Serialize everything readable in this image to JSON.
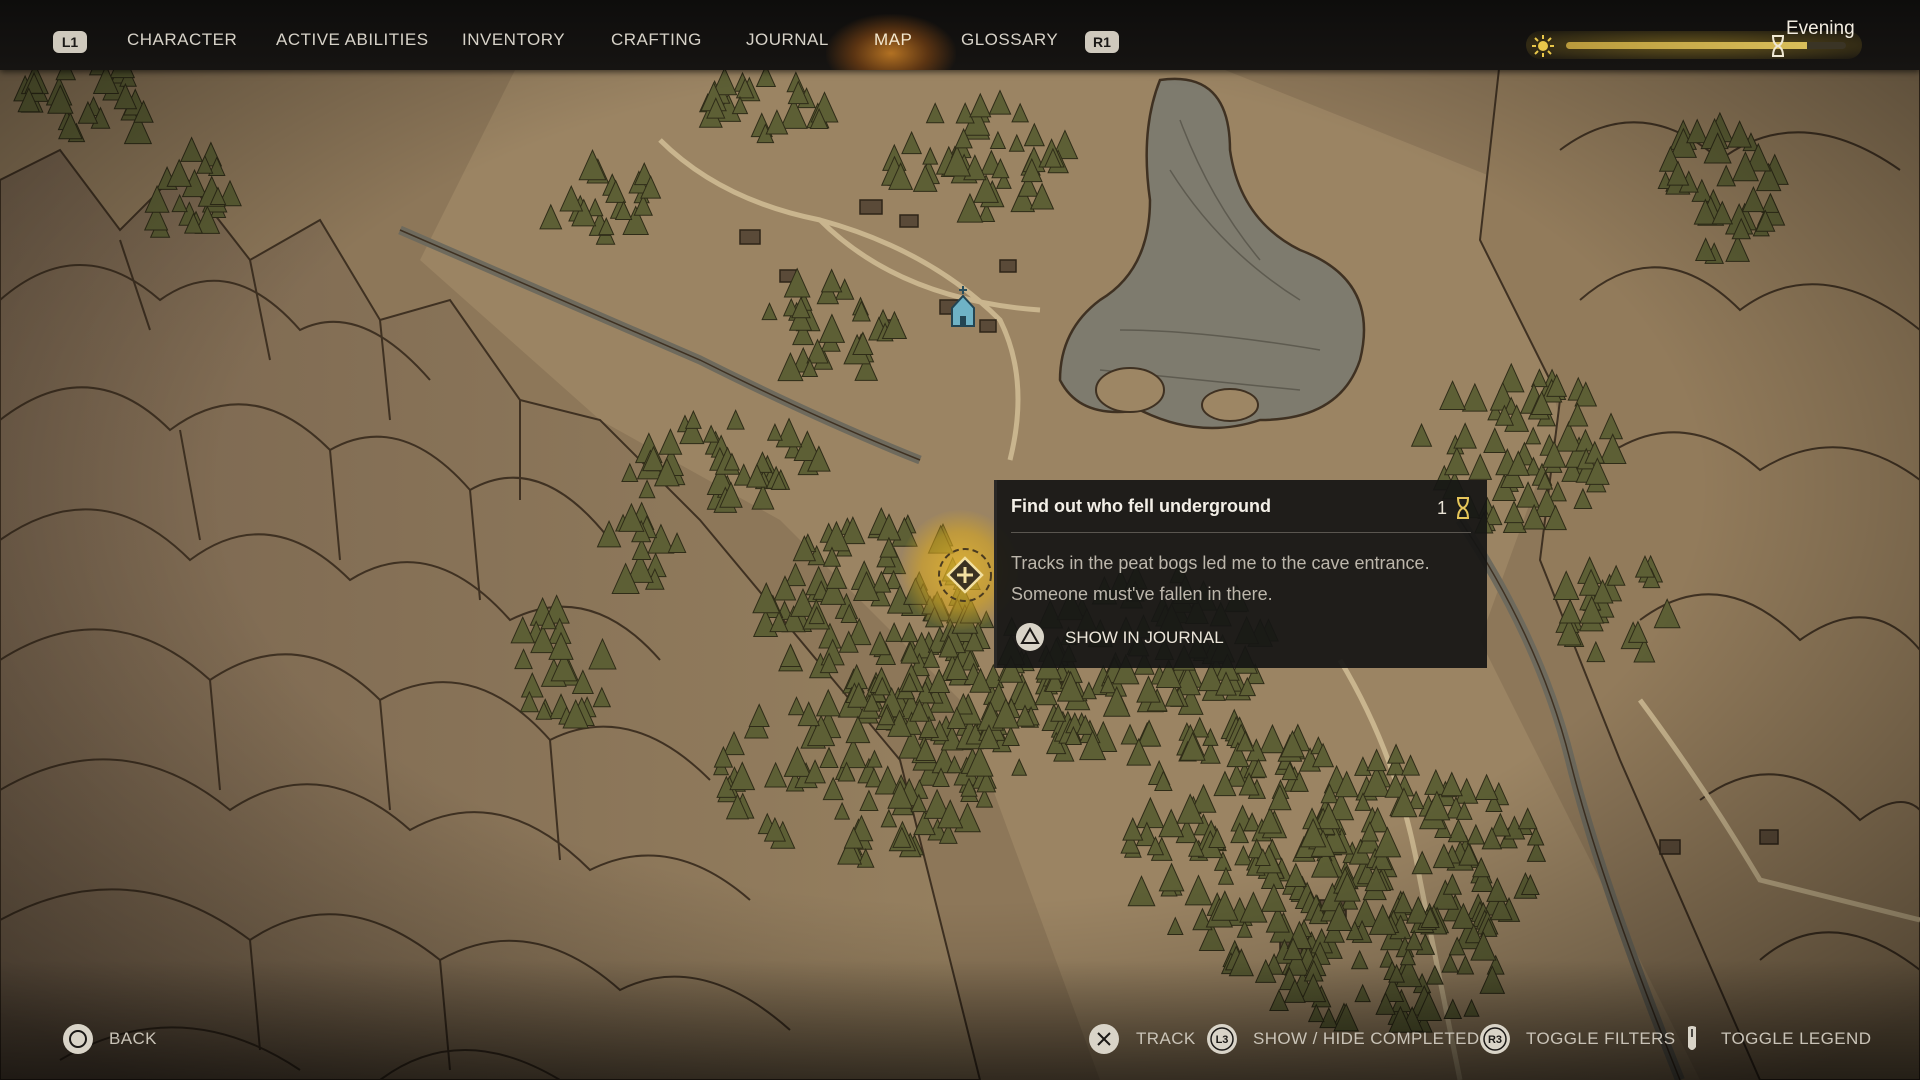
{
  "topbar": {
    "left_shoulder": "L1",
    "right_shoulder": "R1",
    "tabs": [
      {
        "label": "CHARACTER"
      },
      {
        "label": "ACTIVE ABILITIES"
      },
      {
        "label": "INVENTORY"
      },
      {
        "label": "CRAFTING"
      },
      {
        "label": "JOURNAL"
      },
      {
        "label": "MAP",
        "active": true
      },
      {
        "label": "GLOSSARY"
      }
    ],
    "time_of_day": "Evening",
    "time_progress": 0.86,
    "icons": {
      "sun": "sun-icon",
      "time_marker": "hourglass-icon"
    }
  },
  "map": {
    "markers": [
      "church-icon",
      "quest-marker-icon"
    ]
  },
  "quest_tooltip": {
    "title": "Find out who fell underground",
    "count": "1",
    "count_icon": "hourglass-icon",
    "description": "Tracks in the peat bogs led me to the cave entrance. Someone must've fallen in there.",
    "action": {
      "icon": "triangle-button-icon",
      "label": "SHOW IN JOURNAL"
    }
  },
  "hints": {
    "back": {
      "icon": "circle-button-icon",
      "label": "BACK"
    },
    "track": {
      "icon": "cross-button-icon",
      "label": "TRACK"
    },
    "show_hide": {
      "icon": "l3-button-icon",
      "label": "SHOW / HIDE COMPLETED"
    },
    "filters": {
      "icon": "r3-button-icon",
      "label": "TOGGLE FILTERS"
    },
    "legend": {
      "icon": "touchpad-icon",
      "label": "TOGGLE LEGEND"
    }
  },
  "colors": {
    "parchment": "#8a7458",
    "ink": "#4a3b2a",
    "forest": "#5b5e34",
    "water": "#7d7a6c",
    "accent_gold": "#e0b430"
  }
}
